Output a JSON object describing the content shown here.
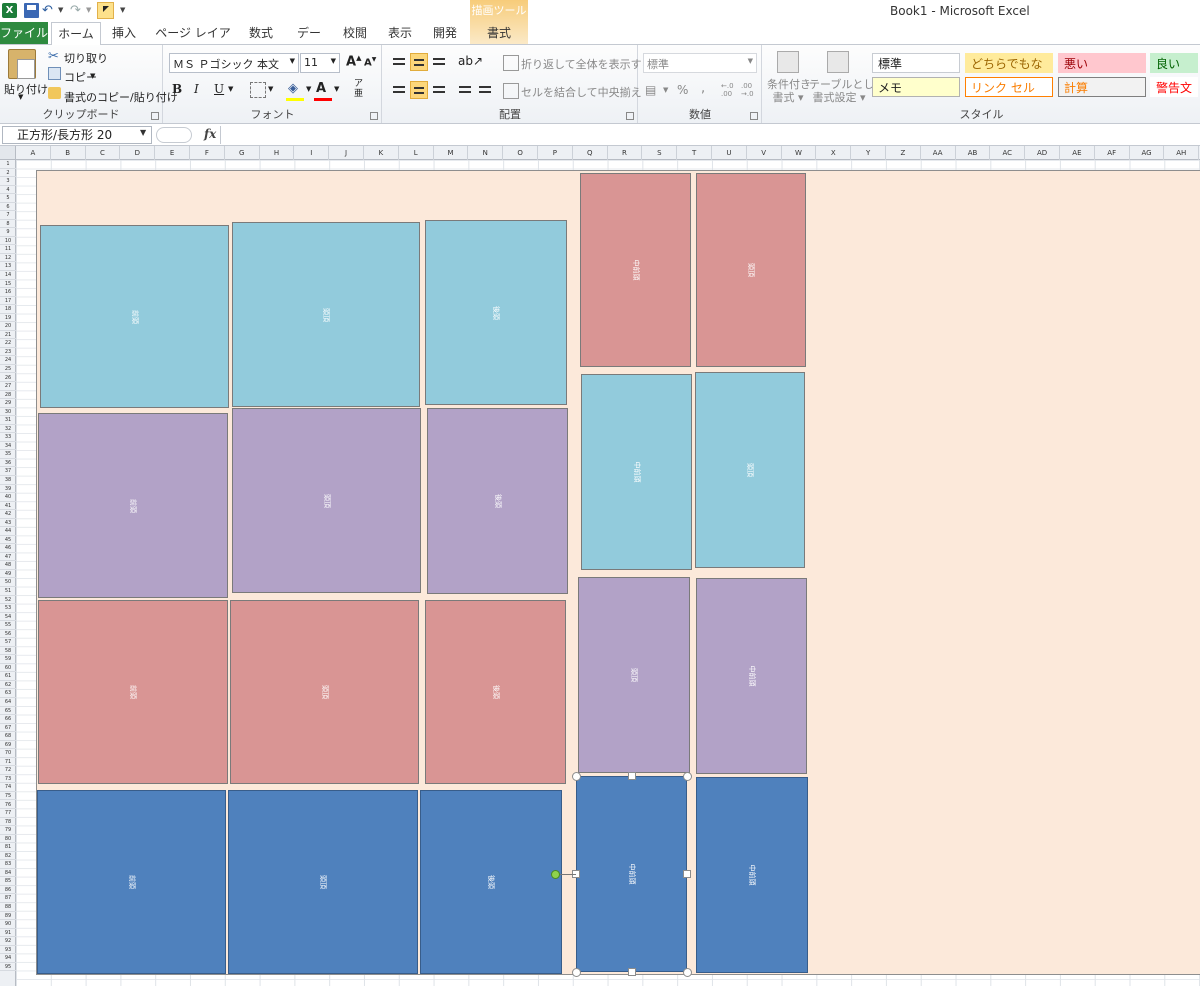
{
  "window": {
    "title": "Book1 - Microsoft Excel",
    "app_icon": "X"
  },
  "tabs": {
    "file": "ファイル",
    "home": "ホーム",
    "insert": "挿入",
    "page_layout": "ページ レイアウト",
    "formulas": "数式",
    "data": "データ",
    "review": "校閲",
    "view": "表示",
    "developer": "開発",
    "context_group": "描画ツール",
    "format": "書式"
  },
  "ribbon": {
    "clipboard": {
      "label": "クリップボード",
      "paste": "貼り付け",
      "cut": "切り取り",
      "copy": "コピー",
      "format_painter": "書式のコピー/貼り付け"
    },
    "font": {
      "label": "フォント",
      "font_name": "ＭＳ Ｐゴシック 本文",
      "font_size": "11",
      "bold": "B",
      "italic": "I",
      "underline": "U"
    },
    "alignment": {
      "label": "配置",
      "wrap_text": "折り返して全体を表示する",
      "merge_center": "セルを結合して中央揃え"
    },
    "number": {
      "label": "数値",
      "format": "標準",
      "percent": "%",
      "comma": ","
    },
    "styles": {
      "label": "スタイル",
      "conditional_formatting": [
        "条件付き",
        "書式"
      ],
      "format_as_table": [
        "テーブルとして",
        "書式設定"
      ],
      "cells": [
        {
          "text": "標準",
          "bg": "#ffffff",
          "color": "#222222",
          "border": "#c8ccd2"
        },
        {
          "text": "どちらでもない",
          "bg": "#ffeb9c",
          "color": "#9c6500",
          "border": "#ffeb9c"
        },
        {
          "text": "悪い",
          "bg": "#ffc7ce",
          "color": "#9c0006",
          "border": "#ffc7ce"
        },
        {
          "text": "良い",
          "bg": "#c6efce",
          "color": "#006100",
          "border": "#c6efce"
        },
        {
          "text": "メモ",
          "bg": "#ffffcc",
          "color": "#222222",
          "border": "#b2b2b2"
        },
        {
          "text": "リンク セル",
          "bg": "#ffffff",
          "color": "#fa7d00",
          "border": "#ff8001"
        },
        {
          "text": "計算",
          "bg": "#f2f2f2",
          "color": "#fa7d00",
          "border": "#7f7f7f"
        },
        {
          "text": "警告文",
          "bg": "#ffffff",
          "color": "#ff0000",
          "border": "#ffffff"
        }
      ]
    }
  },
  "formula_bar": {
    "name_box": "正方形/長方形 20",
    "fx": "fx",
    "value": ""
  },
  "sheet": {
    "columns": [
      "A",
      "B",
      "C",
      "D",
      "E",
      "F",
      "G",
      "H",
      "I",
      "J",
      "K",
      "L",
      "M",
      "N",
      "O",
      "P",
      "Q",
      "R",
      "S",
      "T",
      "U",
      "V",
      "W",
      "X",
      "Y",
      "Z",
      "AA",
      "AB",
      "AC",
      "AD",
      "AE",
      "AF",
      "AG",
      "AH"
    ],
    "row_count": 95
  },
  "shapes": [
    {
      "text": "前頭",
      "color": "cyan"
    },
    {
      "text": "頭頂",
      "color": "cyan"
    },
    {
      "text": "後頭",
      "color": "cyan"
    },
    {
      "text": "中前頭",
      "color": "red"
    },
    {
      "text": "頭頂",
      "color": "red"
    },
    {
      "text": "前頭",
      "color": "purple"
    },
    {
      "text": "頭頂",
      "color": "purple"
    },
    {
      "text": "後頭",
      "color": "purple"
    },
    {
      "text": "中前頭",
      "color": "cyan"
    },
    {
      "text": "頭頂",
      "color": "cyan"
    },
    {
      "text": "前頭",
      "color": "red"
    },
    {
      "text": "頭頂",
      "color": "red"
    },
    {
      "text": "後頭",
      "color": "red"
    },
    {
      "text": "頭頂",
      "color": "purple"
    },
    {
      "text": "中前頭",
      "color": "purple"
    },
    {
      "text": "前頭",
      "color": "blue"
    },
    {
      "text": "頭頂",
      "color": "blue"
    },
    {
      "text": "後頭",
      "color": "blue"
    },
    {
      "text": "中前頭",
      "color": "blue",
      "selected": true
    },
    {
      "text": "中前頭",
      "color": "blue"
    }
  ]
}
